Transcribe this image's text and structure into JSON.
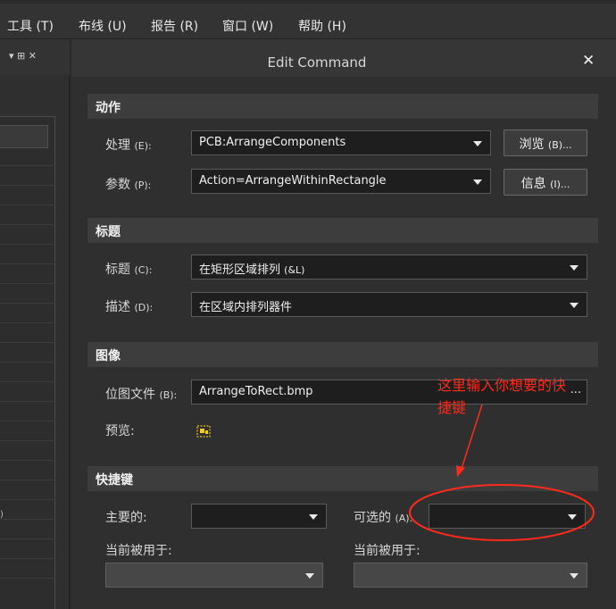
{
  "menu": {
    "tools": "工具 (T)",
    "route": "布线 (U)",
    "reports": "报告 (R)",
    "window": "窗口 (W)",
    "help": "帮助 (H)"
  },
  "left_panel": {
    "controls": "▾ ⊞ ✕",
    "truncated_text": ")"
  },
  "dialog": {
    "title": "Edit Command",
    "close": "✕"
  },
  "sections": {
    "action": "动作",
    "caption": "标题",
    "image": "图像",
    "shortcut": "快捷键"
  },
  "action": {
    "process_label": "处理",
    "process_hotkey": "(E):",
    "process_value": "PCB:ArrangeComponents",
    "params_label": "参数",
    "params_hotkey": "(P):",
    "params_value": "Action=ArrangeWithinRectangle",
    "browse_label": "浏览",
    "browse_hotkey": "(B)...",
    "info_label": "信息",
    "info_hotkey": "(I)..."
  },
  "caption": {
    "title_label": "标题",
    "title_hotkey": "(C):",
    "title_value": "在矩形区域排列",
    "title_value_suffix": "(&L)",
    "desc_label": "描述",
    "desc_hotkey": "(D):",
    "desc_value": "在区域内排列器件"
  },
  "image": {
    "bitmap_label": "位图文件",
    "bitmap_hotkey": "(B):",
    "bitmap_value": "ArrangeToRect.bmp",
    "bitmap_more": "...",
    "preview_label": "预览:"
  },
  "shortcut": {
    "primary_label": "主要的:",
    "primary_value": "",
    "alternate_label": "可选的",
    "alternate_hotkey": "(A):",
    "alternate_value": "",
    "current_used_label_1": "当前被用于:",
    "current_used_label_2": "当前被用于:",
    "current_used_value_1": "",
    "current_used_value_2": ""
  },
  "annotation": {
    "line1": "这里输入你想要的快",
    "line2": "捷键"
  },
  "colors": {
    "annotation_red": "#ff2a1a",
    "background": "#2f2f2f",
    "field_dark": "#1e1e1e",
    "section_bar": "#3d3d3d"
  }
}
